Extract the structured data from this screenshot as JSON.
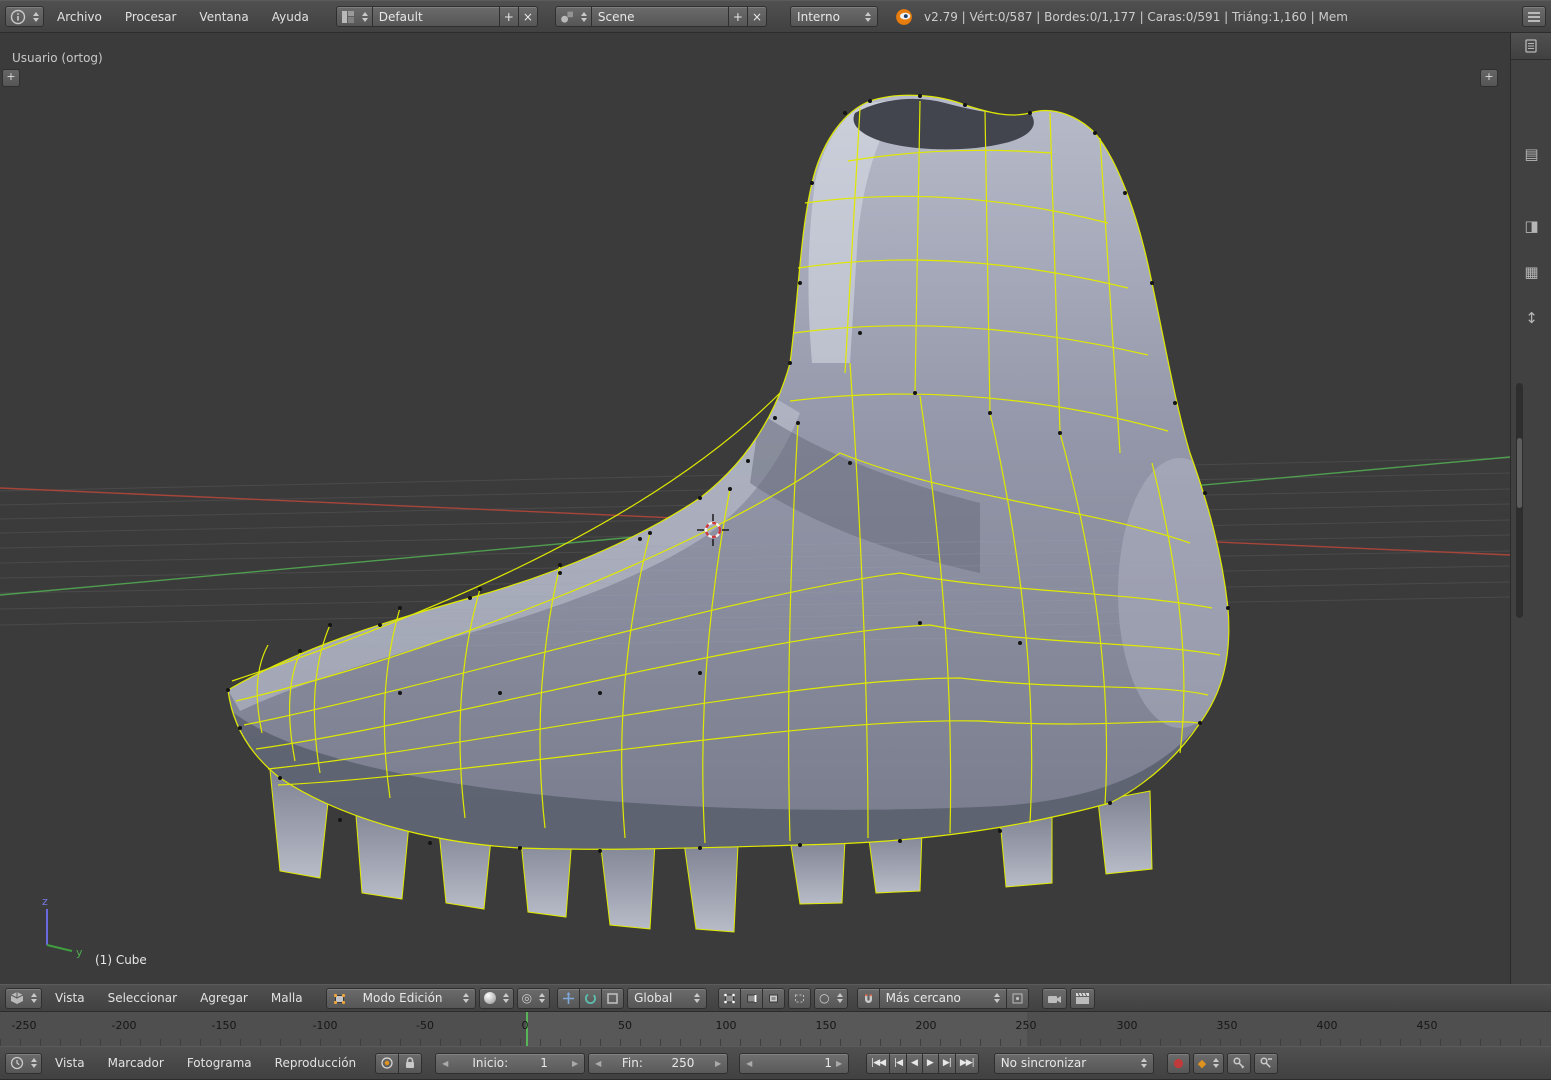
{
  "info_bar": {
    "menus": [
      "Archivo",
      "Procesar",
      "Ventana",
      "Ayuda"
    ],
    "layout_value": "Default",
    "scene_value": "Scene",
    "engine_value": "Interno",
    "stats": "v2.79 | Vért:0/587 | Bordes:0/1,177 | Caras:0/591 | Triáng:1,160 | Mem",
    "add_label": "+",
    "close_label": "×"
  },
  "viewport": {
    "view_label": "Usuario (ortog)",
    "active_object": "(1) Cube",
    "axis_z": "z",
    "axis_y": "y",
    "expand_label": "+"
  },
  "view3d_header": {
    "menus": [
      "Vista",
      "Seleccionar",
      "Agregar",
      "Malla"
    ],
    "mode_value": "Modo Edición",
    "orientation_value": "Global",
    "snap_value": "Más cercano",
    "prop_edit_glyph": "○",
    "pivot_glyph": "◎"
  },
  "timeline": {
    "menus": [
      "Vista",
      "Marcador",
      "Fotograma",
      "Reproducción"
    ],
    "start_label": "Inicio:",
    "start_value": "1",
    "end_label": "Fin:",
    "end_value": "250",
    "current_frame": "1",
    "sync_value": "No sincronizar",
    "keying_glyph": "◆",
    "ruler_ticks": [
      "-250",
      "-200",
      "-150",
      "-100",
      "-50",
      "0",
      "50",
      "100",
      "150",
      "200",
      "250",
      "300",
      "350",
      "400",
      "450"
    ],
    "playback": [
      {
        "name": "jump-to-start",
        "glyph": "|◀◀"
      },
      {
        "name": "prev-keyframe",
        "glyph": "|◀"
      },
      {
        "name": "play-reverse",
        "glyph": "◀"
      },
      {
        "name": "play",
        "glyph": "▶"
      },
      {
        "name": "next-keyframe",
        "glyph": "▶|"
      },
      {
        "name": "jump-to-end",
        "glyph": "▶▶|"
      }
    ]
  },
  "colors": {
    "wire": "#dfe900",
    "axis_x_line": "#a8453a",
    "axis_y_line": "#4f9d4f",
    "record": "#c23b3b",
    "keying_orange": "#e0921f",
    "blender_orange": "#e87d0d"
  }
}
